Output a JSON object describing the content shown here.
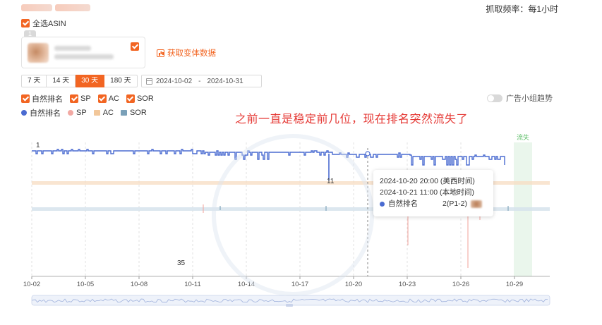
{
  "header": {
    "title": "",
    "frequency_label": "抓取频率：每1小时"
  },
  "asin": {
    "select_all_label": "全选ASIN",
    "tag": "1",
    "fetch_variants_label": "获取变体数据"
  },
  "range": {
    "buttons": [
      "7 天",
      "14 天",
      "30 天",
      "180 天"
    ],
    "active": "30 天",
    "date_start": "2024-10-02",
    "date_sep": "-",
    "date_end": "2024-10-31"
  },
  "filters": {
    "items": [
      "自然排名",
      "SP",
      "AC",
      "SOR"
    ],
    "ad_group_trend_label": "广告小组趋势"
  },
  "legend": {
    "items": [
      {
        "label": "自然排名",
        "color": "#4a6bd1",
        "shape": "dot"
      },
      {
        "label": "SP",
        "color": "#f2a9a3",
        "shape": "dot"
      },
      {
        "label": "AC",
        "color": "#f2c79a",
        "shape": "square"
      },
      {
        "label": "SOR",
        "color": "#7aa0b8",
        "shape": "square"
      }
    ]
  },
  "annotation_text": "之前一直是稳定前几位，现在排名突然流失了",
  "chart_data": {
    "type": "line",
    "x_ticks": [
      "10-02",
      "10-05",
      "10-08",
      "10-11",
      "10-14",
      "10-17",
      "10-20",
      "10-23",
      "10-26",
      "10-29"
    ],
    "xlim": [
      "10-02",
      "10-31"
    ],
    "y_axis": {
      "inverted": true,
      "min_label": "1",
      "max_label": "35",
      "ylim": [
        1,
        35
      ]
    },
    "point_labels": [
      {
        "text": "1",
        "x": "10-02",
        "y": 1
      },
      {
        "text": "11",
        "x": "10-18",
        "y": 11
      },
      {
        "text": "35",
        "x": "10-10",
        "y": 35
      }
    ],
    "highlight_band_label": "流失",
    "series": [
      {
        "name": "自然排名",
        "color": "#4a6bd1"
      },
      {
        "name": "SP",
        "color": "#f2a9a3"
      },
      {
        "name": "AC",
        "color": "#f2c79a"
      },
      {
        "name": "SOR",
        "color": "#7aa0b8"
      }
    ]
  },
  "tooltip": {
    "line1": "2024-10-20 20:00 (美西时间)",
    "line2": "2024-10-21 11:00 (本地时间)",
    "series_name": "自然排名",
    "value": "2(P1-2)"
  }
}
